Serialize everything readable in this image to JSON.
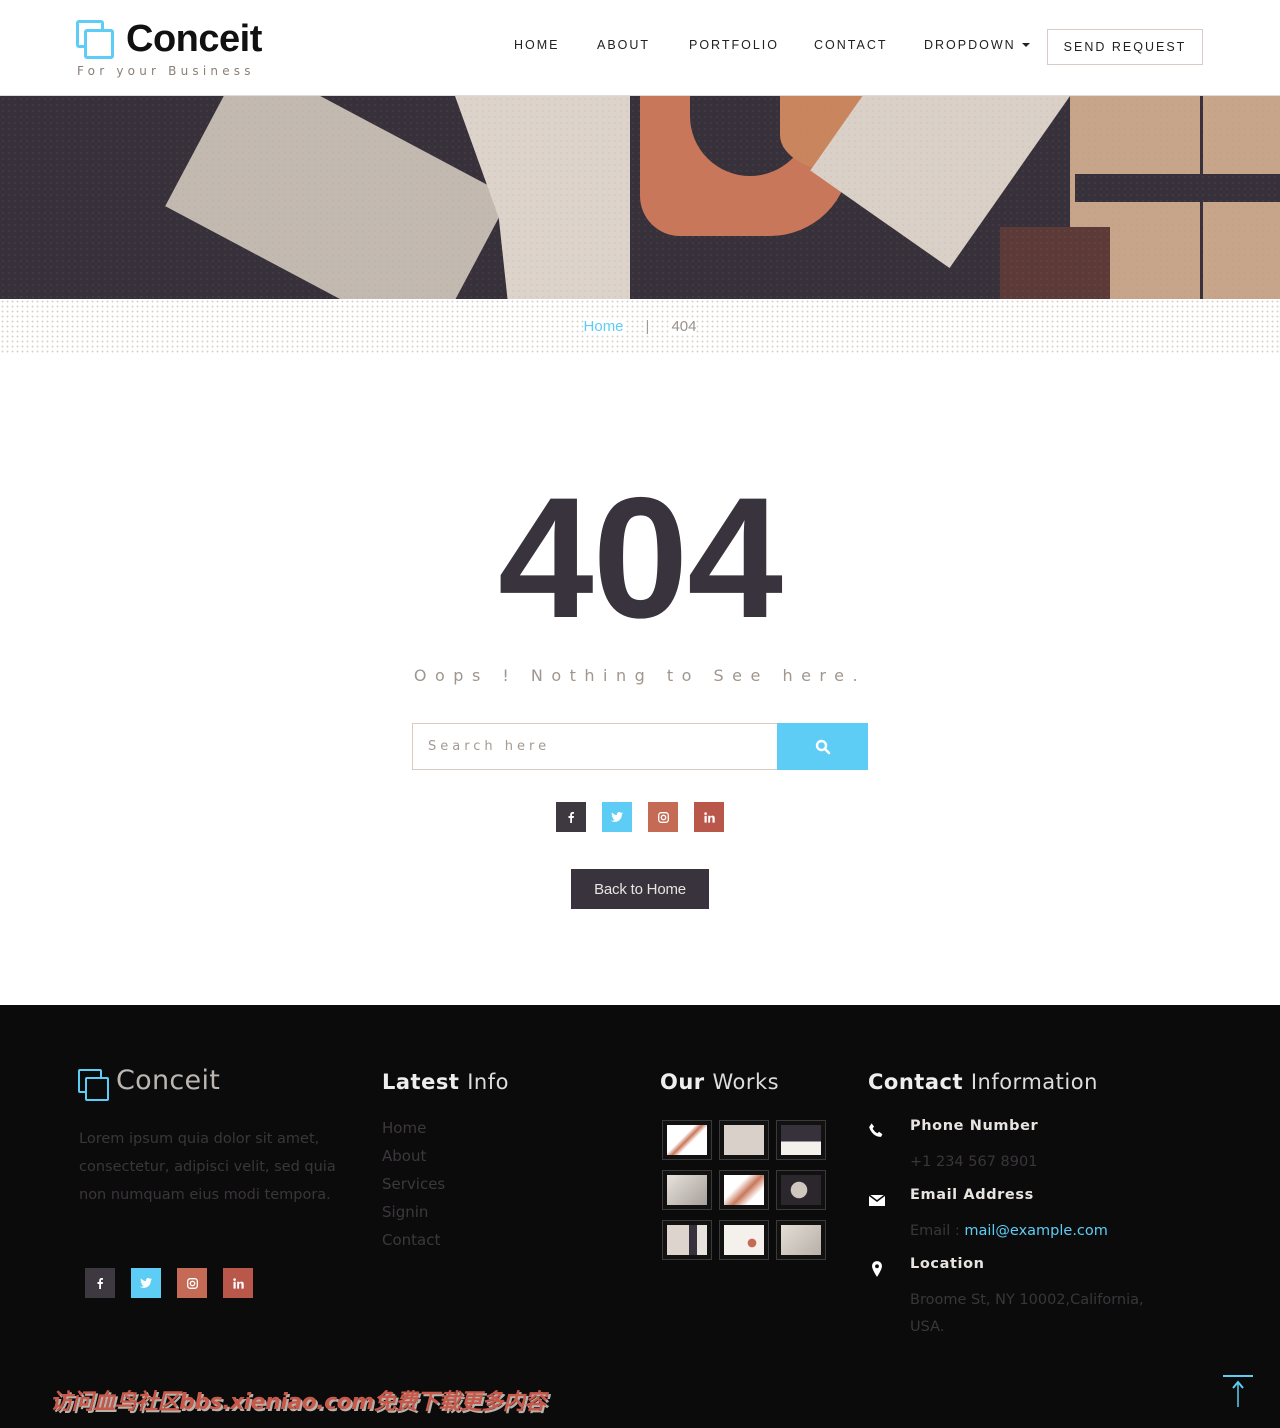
{
  "header": {
    "logo_text": "Conceit",
    "logo_tagline": "For your Business",
    "nav": [
      {
        "label": "HOME"
      },
      {
        "label": "ABOUT"
      },
      {
        "label": "PORTFOLIO"
      },
      {
        "label": "CONTACT"
      },
      {
        "label": "DROPDOWN"
      }
    ],
    "cta_label": "SEND REQUEST"
  },
  "breadcrumb": {
    "home": "Home",
    "separator": "|",
    "current": "404"
  },
  "error": {
    "code": "404",
    "message": "Oops ! Nothing to See here.",
    "search_placeholder": "Search here",
    "search_value": "",
    "search_icon": "search-icon",
    "back_label": "Back to Home"
  },
  "social": [
    {
      "name": "facebook",
      "glyph": "f",
      "color": "#3e3940"
    },
    {
      "name": "twitter",
      "glyph": "t",
      "color": "#5ecdf5"
    },
    {
      "name": "instagram",
      "glyph": "ig",
      "color": "#c56a55"
    },
    {
      "name": "linkedin",
      "glyph": "in",
      "color": "#b8574a"
    }
  ],
  "footer": {
    "logo_text": "Conceit",
    "about": "Lorem ipsum quia dolor sit amet, consectetur, adipisci velit, sed quia non numquam eius modi tempora.",
    "latest": {
      "title_bold": "Latest",
      "title_light": "Info",
      "links": [
        "Home",
        "About",
        "Services",
        "Signin",
        "Contact"
      ]
    },
    "works": {
      "title_bold": "Our",
      "title_light": "Works",
      "count": 9
    },
    "contact": {
      "title_bold": "Contact",
      "title_light": "Information",
      "phone_title": "Phone Number",
      "phone": "+1 234 567 8901",
      "email_title": "Email Address",
      "email_label": "Email :",
      "email": "mail@example.com",
      "location_title": "Location",
      "location": "Broome St, NY 10002,California, USA."
    }
  },
  "watermark": "访问血鸟社区bbs.xieniao.com免费下载更多内容",
  "colors": {
    "accent": "#5ecdf5",
    "dark": "#38333c",
    "footer_bg": "#0b0b0b",
    "muted": "#9f968f"
  }
}
